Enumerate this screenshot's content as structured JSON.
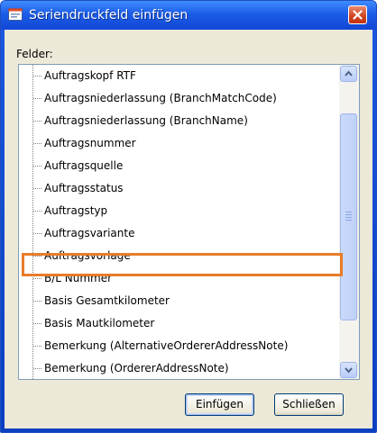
{
  "window": {
    "title": "Seriendruckfeld einfügen"
  },
  "fields_label": "Felder:",
  "items": [
    {
      "label": "Auftragskopf RTF"
    },
    {
      "label": "Auftragsniederlassung (BranchMatchCode)"
    },
    {
      "label": "Auftragsniederlassung (BranchName)"
    },
    {
      "label": "Auftragsnummer"
    },
    {
      "label": "Auftragsquelle"
    },
    {
      "label": "Auftragsstatus"
    },
    {
      "label": "Auftragstyp"
    },
    {
      "label": "Auftragsvariante",
      "highlighted": true
    },
    {
      "label": "Auftragsvorlage"
    },
    {
      "label": "B/L Nummer"
    },
    {
      "label": "Basis Gesamtkilometer"
    },
    {
      "label": "Basis Mautkilometer"
    },
    {
      "label": "Bemerkung (AlternativeOrdererAddressNote)"
    },
    {
      "label": "Bemerkung (OrdererAddressNote)"
    }
  ],
  "buttons": {
    "insert_label": "Einfügen",
    "close_label": "Schließen"
  },
  "colors": {
    "highlight_border": "#e87c2a",
    "titlebar": "#1c5de8"
  }
}
